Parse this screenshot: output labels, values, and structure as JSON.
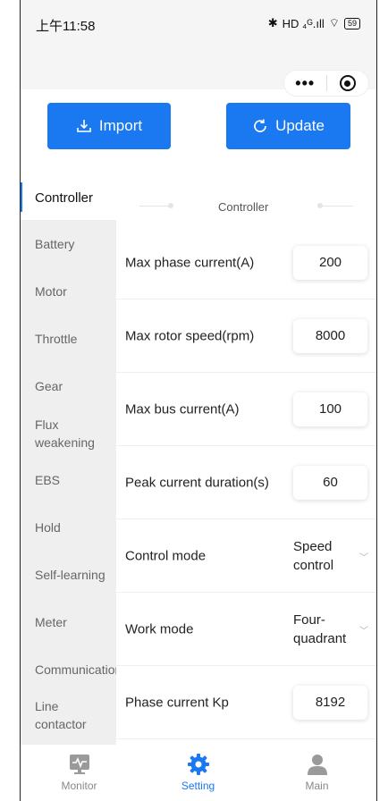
{
  "status_bar": {
    "time": "上午11:58",
    "bluetooth": "✱",
    "signal": "HD ₄ᴳ.ıll",
    "wifi": "⌔",
    "battery": "59"
  },
  "capsule": {
    "more": "•••"
  },
  "actions": {
    "import_label": "Import",
    "update_label": "Update"
  },
  "sidebar": {
    "active": "Controller",
    "items": [
      "Battery",
      "Motor",
      "Throttle",
      "Gear",
      "Flux weakening",
      "EBS",
      "Hold",
      "Self-learning",
      "Meter",
      "Communication",
      "Line contactor"
    ]
  },
  "section": {
    "title": "Controller"
  },
  "rows": [
    {
      "label": "Max phase current(A)",
      "value": "200"
    },
    {
      "label": "Max rotor speed(rpm)",
      "value": "8000"
    },
    {
      "label": "Max bus current(A)",
      "value": "100"
    },
    {
      "label": "Peak current duration(s)",
      "value": "60"
    },
    {
      "label": "Control mode",
      "value": "Speed control"
    },
    {
      "label": "Work mode",
      "value": "Four-quadrant"
    },
    {
      "label": "Phase current Kp",
      "value": "8192"
    }
  ],
  "tabbar": {
    "tabs": [
      {
        "label": "Monitor",
        "icon": "monitor-icon"
      },
      {
        "label": "Setting",
        "icon": "gear-icon"
      },
      {
        "label": "Main",
        "icon": "user-icon"
      }
    ]
  },
  "colors": {
    "accent": "#1a78f0",
    "sidebar_bg": "#efefef",
    "status_bg": "#f5f5f5"
  }
}
